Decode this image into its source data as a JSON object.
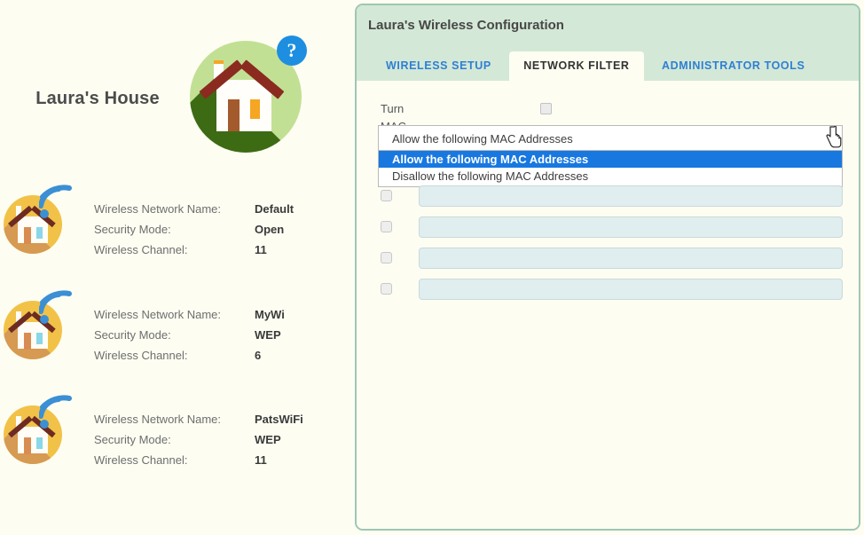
{
  "left": {
    "house_title": "Laura's House",
    "help_badge": "?",
    "networks": [
      {
        "icon": "wifi-house-icon",
        "rows": [
          {
            "label": "Wireless Network Name:",
            "value": "Default"
          },
          {
            "label": "Security Mode:",
            "value": "Open"
          },
          {
            "label": "Wireless Channel:",
            "value": "11"
          }
        ]
      },
      {
        "icon": "wifi-house-icon",
        "rows": [
          {
            "label": "Wireless Network Name:",
            "value": "MyWi"
          },
          {
            "label": "Security Mode:",
            "value": "WEP"
          },
          {
            "label": "Wireless Channel:",
            "value": "6"
          }
        ]
      },
      {
        "icon": "wifi-house-icon",
        "rows": [
          {
            "label": "Wireless Network Name:",
            "value": "PatsWiFi"
          },
          {
            "label": "Security Mode:",
            "value": "WEP"
          },
          {
            "label": "Wireless Channel:",
            "value": "11"
          }
        ]
      }
    ]
  },
  "panel": {
    "title": "Laura's Wireless Configuration",
    "tabs": [
      {
        "label": "WIRELESS SETUP",
        "active": false
      },
      {
        "label": "NETWORK FILTER",
        "active": true
      },
      {
        "label": "ADMINISTRATOR TOOLS",
        "active": false
      }
    ],
    "mac_filter": {
      "toggle_label": "Turn MAC Filtering ON:",
      "toggle_checked": false,
      "dropdown": {
        "selected": "Allow the following MAC Addresses",
        "expanded": true,
        "options": [
          {
            "label": "Allow the following MAC Addresses",
            "highlighted": true
          },
          {
            "label": "Disallow the following MAC Addresses",
            "highlighted": false
          }
        ]
      },
      "address_rows": [
        {
          "checked": false,
          "value": ""
        },
        {
          "checked": false,
          "value": ""
        },
        {
          "checked": false,
          "value": ""
        },
        {
          "checked": false,
          "value": ""
        }
      ]
    }
  },
  "colors": {
    "page_bg": "#fdfdf2",
    "panel_header_bg": "#d3e8d6",
    "panel_border": "#9fc6b4",
    "tab_link": "#2f7fd4",
    "highlight_blue": "#1878e0",
    "input_fill": "#e0eef0",
    "house_circle_green": "#c2e094",
    "house_shadow_green": "#3d6b14",
    "roof_red": "#8b2b20",
    "accent_orange": "#f5a623",
    "small_icon_yellow": "#f2c248",
    "wifi_blue": "#3b8fd4",
    "help_badge_blue": "#1e8fe0"
  }
}
